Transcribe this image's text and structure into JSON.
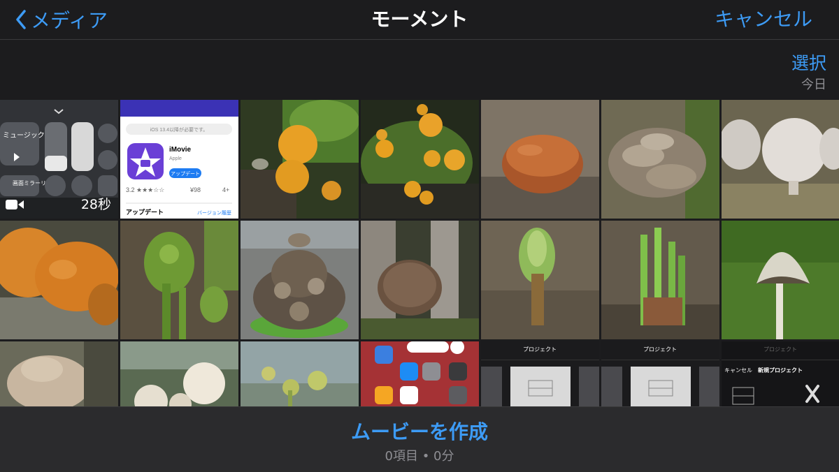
{
  "navbar": {
    "back_label": "メディア",
    "title": "モーメント",
    "cancel_label": "キャンセル"
  },
  "section": {
    "select_label": "選択",
    "date_label": "今日"
  },
  "grid": {
    "video_duration": "28秒",
    "control_center": {
      "music_label": "ミュージック",
      "mirroring_label": "画面ミラーリング"
    },
    "app_store": {
      "requirement": "iOS 13.4以降が必要です。",
      "app_name": "iMovie",
      "developer": "Apple",
      "update_button": "アップデート",
      "rating": "3.2 ★★★☆☆",
      "price": "¥98",
      "age": "4+",
      "updates_heading": "アップデート",
      "version_history": "バージョン履歴"
    },
    "project_label": "プロジェクト",
    "project_cancel": "キャンセル",
    "new_project": "新規プロジェクト"
  },
  "bottom": {
    "create_label": "ムービーを作成",
    "summary": "0項目 • 0分"
  },
  "colors": {
    "accent": "#3d9bf5",
    "background": "#1c1c1e",
    "secondary_text": "#8e8e93"
  }
}
